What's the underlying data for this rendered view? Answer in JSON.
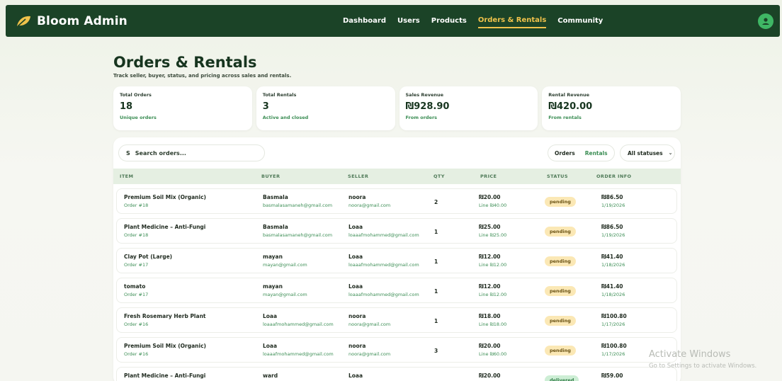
{
  "app": {
    "brand": "Bloom Admin"
  },
  "nav": [
    {
      "label": "Dashboard",
      "active": false
    },
    {
      "label": "Users",
      "active": false
    },
    {
      "label": "Products",
      "active": false
    },
    {
      "label": "Orders & Rentals",
      "active": true
    },
    {
      "label": "Community",
      "active": false
    }
  ],
  "header": {
    "title": "Orders & Rentals",
    "subtitle": "Track seller, buyer, status, and pricing across sales and rentals."
  },
  "stats": [
    {
      "label": "Total Orders",
      "value": "18",
      "note": "Unique orders"
    },
    {
      "label": "Total Rentals",
      "value": "3",
      "note": "Active and closed"
    },
    {
      "label": "Sales Revenue",
      "value": "₪928.90",
      "note": "From orders"
    },
    {
      "label": "Rental Revenue",
      "value": "₪420.00",
      "note": "From rentals"
    }
  ],
  "toolbar": {
    "search_placeholder": "Search orders...",
    "toggle": [
      "Orders",
      "Rentals"
    ],
    "status_filter": "All statuses"
  },
  "columns": [
    "ITEM",
    "BUYER",
    "SELLER",
    "QTY",
    "PRICE",
    "STATUS",
    "ORDER INFO"
  ],
  "rows": [
    {
      "item": "Premium Soil Mix (Organic)",
      "order": "Order #18",
      "buyer": "Basmala",
      "buyer_email": "basmalasamaneh@gmail.com",
      "seller": "noora",
      "seller_email": "noora@gmail.com",
      "qty": "2",
      "price": "₪20.00",
      "line": "Line ₪40.00",
      "status": "pending",
      "total": "₪86.50",
      "date": "1/19/2026"
    },
    {
      "item": "Plant Medicine – Anti-Fungi",
      "order": "Order #18",
      "buyer": "Basmala",
      "buyer_email": "basmalasamaneh@gmail.com",
      "seller": "Loaa",
      "seller_email": "loaaafmohammed@gmail.com",
      "qty": "1",
      "price": "₪25.00",
      "line": "Line ₪25.00",
      "status": "pending",
      "total": "₪86.50",
      "date": "1/19/2026"
    },
    {
      "item": "Clay Pot (Large)",
      "order": "Order #17",
      "buyer": "mayan",
      "buyer_email": "mayan@gmail.com",
      "seller": "Loaa",
      "seller_email": "loaaafmohammed@gmail.com",
      "qty": "1",
      "price": "₪12.00",
      "line": "Line ₪12.00",
      "status": "pending",
      "total": "₪41.40",
      "date": "1/18/2026"
    },
    {
      "item": "tomato",
      "order": "Order #17",
      "buyer": "mayan",
      "buyer_email": "mayan@gmail.com",
      "seller": "Loaa",
      "seller_email": "loaaafmohammed@gmail.com",
      "qty": "1",
      "price": "₪12.00",
      "line": "Line ₪12.00",
      "status": "pending",
      "total": "₪41.40",
      "date": "1/18/2026"
    },
    {
      "item": "Fresh Rosemary Herb Plant",
      "order": "Order #16",
      "buyer": "Loaa",
      "buyer_email": "loaaafmohammed@gmail.com",
      "seller": "noora",
      "seller_email": "noora@gmail.com",
      "qty": "1",
      "price": "₪18.00",
      "line": "Line ₪18.00",
      "status": "pending",
      "total": "₪100.80",
      "date": "1/17/2026"
    },
    {
      "item": "Premium Soil Mix (Organic)",
      "order": "Order #16",
      "buyer": "Loaa",
      "buyer_email": "loaaafmohammed@gmail.com",
      "seller": "noora",
      "seller_email": "noora@gmail.com",
      "qty": "3",
      "price": "₪20.00",
      "line": "Line ₪60.00",
      "status": "pending",
      "total": "₪100.80",
      "date": "1/17/2026"
    },
    {
      "item": "Plant Medicine – Anti-Fungi",
      "order": "",
      "buyer": "ward",
      "buyer_email": "",
      "seller": "Loaa",
      "seller_email": "",
      "qty": "",
      "price": "₪20.00",
      "line": "",
      "status": "delivered",
      "total": "₪59.00",
      "date": ""
    }
  ],
  "watermark": {
    "title": "Activate Windows",
    "subtitle": "Go to Settings to activate Windows."
  },
  "colors": {
    "header_bg": "#1b4327",
    "accent_active": "#f0c24b",
    "green_text": "#3c8e55",
    "pending_bg": "#fbe8b5",
    "avatar": "#3fb765"
  },
  "icons": {
    "brand": "leaf-icon",
    "avatar": "user-circle-icon",
    "search": "search-icon",
    "filter": "chevron-down-icon"
  }
}
